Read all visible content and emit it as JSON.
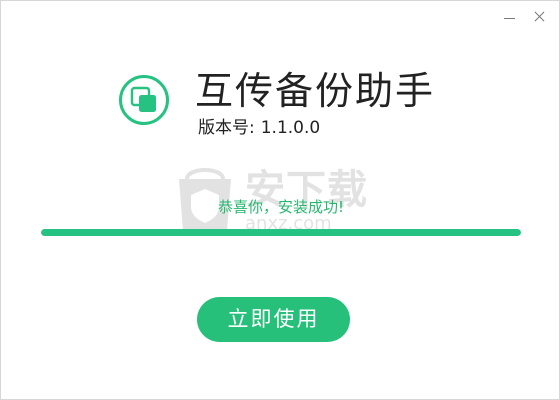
{
  "app": {
    "title": "互传备份助手",
    "version_label": "版本号:",
    "version_value": "1.1.0.0"
  },
  "status": {
    "message": "恭喜你，安装成功!",
    "progress_percent": 100
  },
  "actions": {
    "start_label": "立即使用"
  },
  "watermark": {
    "text": "安下载",
    "subtext": "anxz.com"
  },
  "icons": {
    "logo": "copy-squares-icon",
    "minimize": "minimize-icon",
    "close": "close-icon",
    "watermark": "shield-bag-icon"
  },
  "colors": {
    "accent": "#26c281",
    "button": "#27c07a",
    "success_text": "#26b86f",
    "track": "#e3e3e3"
  }
}
